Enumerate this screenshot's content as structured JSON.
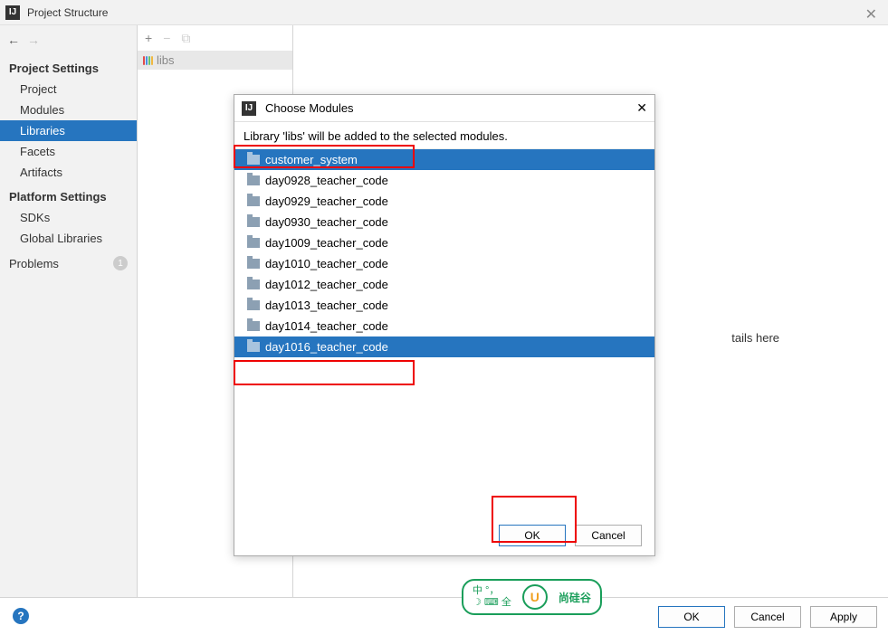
{
  "window": {
    "title": "Project Structure"
  },
  "sidebar": {
    "projectSettings": {
      "heading": "Project Settings",
      "items": [
        "Project",
        "Modules",
        "Libraries",
        "Facets",
        "Artifacts"
      ],
      "selectedIndex": 2
    },
    "platformSettings": {
      "heading": "Platform Settings",
      "items": [
        "SDKs",
        "Global Libraries"
      ]
    },
    "problems": {
      "label": "Problems",
      "count": "1"
    }
  },
  "midPanel": {
    "libLabel": "libs"
  },
  "mainPanel": {
    "hint": "tails here"
  },
  "footer": {
    "ok": "OK",
    "cancel": "Cancel",
    "apply": "Apply"
  },
  "dialog": {
    "title": "Choose Modules",
    "message": "Library 'libs' will be added to the selected modules.",
    "modules": [
      {
        "name": "customer_system",
        "selected": true
      },
      {
        "name": "day0928_teacher_code",
        "selected": false
      },
      {
        "name": "day0929_teacher_code",
        "selected": false
      },
      {
        "name": "day0930_teacher_code",
        "selected": false
      },
      {
        "name": "day1009_teacher_code",
        "selected": false
      },
      {
        "name": "day1010_teacher_code",
        "selected": false
      },
      {
        "name": "day1012_teacher_code",
        "selected": false
      },
      {
        "name": "day1013_teacher_code",
        "selected": false
      },
      {
        "name": "day1014_teacher_code",
        "selected": false
      },
      {
        "name": "day1016_teacher_code",
        "selected": true
      }
    ],
    "ok": "OK",
    "cancel": "Cancel"
  },
  "watermark": {
    "left1": "中 °，",
    "left2": "☽ ⌨ 全",
    "emblem": "U",
    "right": "尚硅谷"
  }
}
